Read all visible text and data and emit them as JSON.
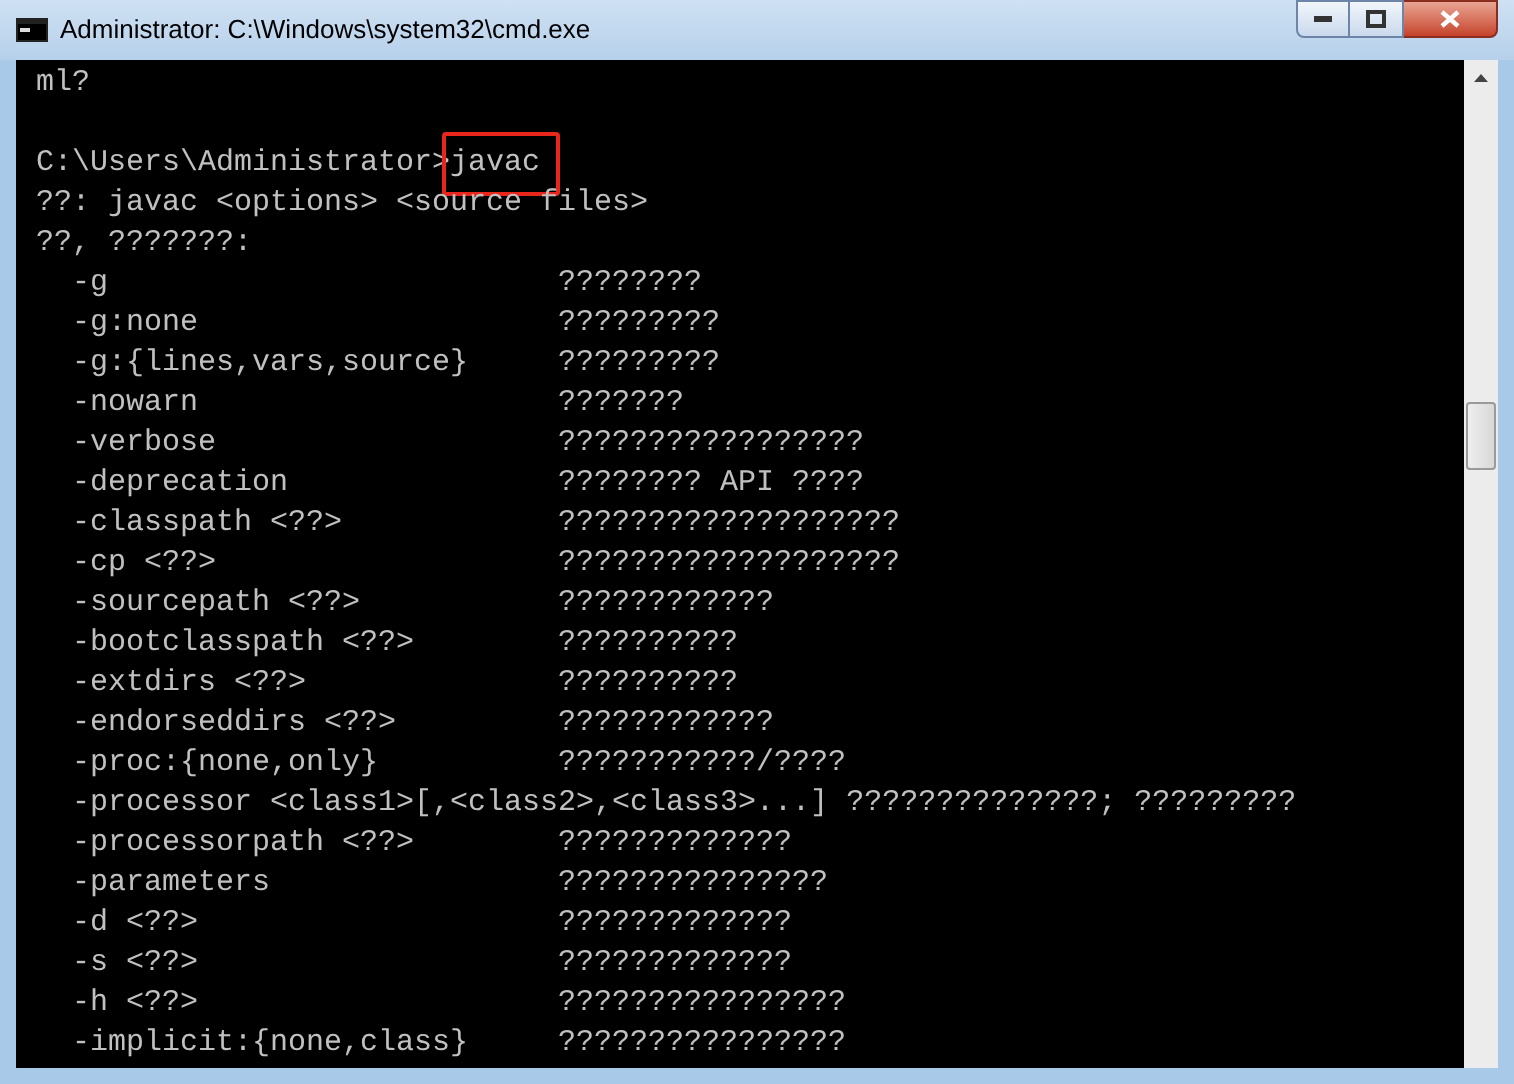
{
  "window": {
    "title": "Administrator: C:\\Windows\\system32\\cmd.exe"
  },
  "console": {
    "lines": [
      {
        "kind": "text",
        "text": "ml?"
      },
      {
        "kind": "blank"
      },
      {
        "kind": "prompt",
        "prompt": "C:\\Users\\Administrator>",
        "command": "javac",
        "highlighted": true
      },
      {
        "kind": "text",
        "text": "??: javac <options> <source files>"
      },
      {
        "kind": "text",
        "text": "??, ???????:"
      },
      {
        "kind": "option",
        "option": "-g",
        "description": "????????"
      },
      {
        "kind": "option",
        "option": "-g:none",
        "description": "?????????"
      },
      {
        "kind": "option",
        "option": "-g:{lines,vars,source}",
        "description": "?????????"
      },
      {
        "kind": "option",
        "option": "-nowarn",
        "description": "???????"
      },
      {
        "kind": "option",
        "option": "-verbose",
        "description": "?????????????????"
      },
      {
        "kind": "option",
        "option": "-deprecation",
        "description": "???????? API ????"
      },
      {
        "kind": "option",
        "option": "-classpath <??>",
        "description": "???????????????????"
      },
      {
        "kind": "option",
        "option": "-cp <??>",
        "description": "???????????????????"
      },
      {
        "kind": "option",
        "option": "-sourcepath <??>",
        "description": "????????????"
      },
      {
        "kind": "option",
        "option": "-bootclasspath <??>",
        "description": "??????????"
      },
      {
        "kind": "option",
        "option": "-extdirs <??>",
        "description": "??????????"
      },
      {
        "kind": "option",
        "option": "-endorseddirs <??>",
        "description": "????????????"
      },
      {
        "kind": "option",
        "option": "-proc:{none,only}",
        "description": "???????????/????"
      },
      {
        "kind": "option",
        "option": "-processor <class1>[,<class2>,<class3>...]",
        "description": "??????????????; ?????????"
      },
      {
        "kind": "option",
        "option": "-processorpath <??>",
        "description": "?????????????"
      },
      {
        "kind": "option",
        "option": "-parameters",
        "description": "???????????????"
      },
      {
        "kind": "option",
        "option": "-d <??>",
        "description": "?????????????"
      },
      {
        "kind": "option",
        "option": "-s <??>",
        "description": "?????????????"
      },
      {
        "kind": "option",
        "option": "-h <??>",
        "description": "????????????????"
      },
      {
        "kind": "option",
        "option": "-implicit:{none,class}",
        "description": "????????????????"
      }
    ]
  }
}
